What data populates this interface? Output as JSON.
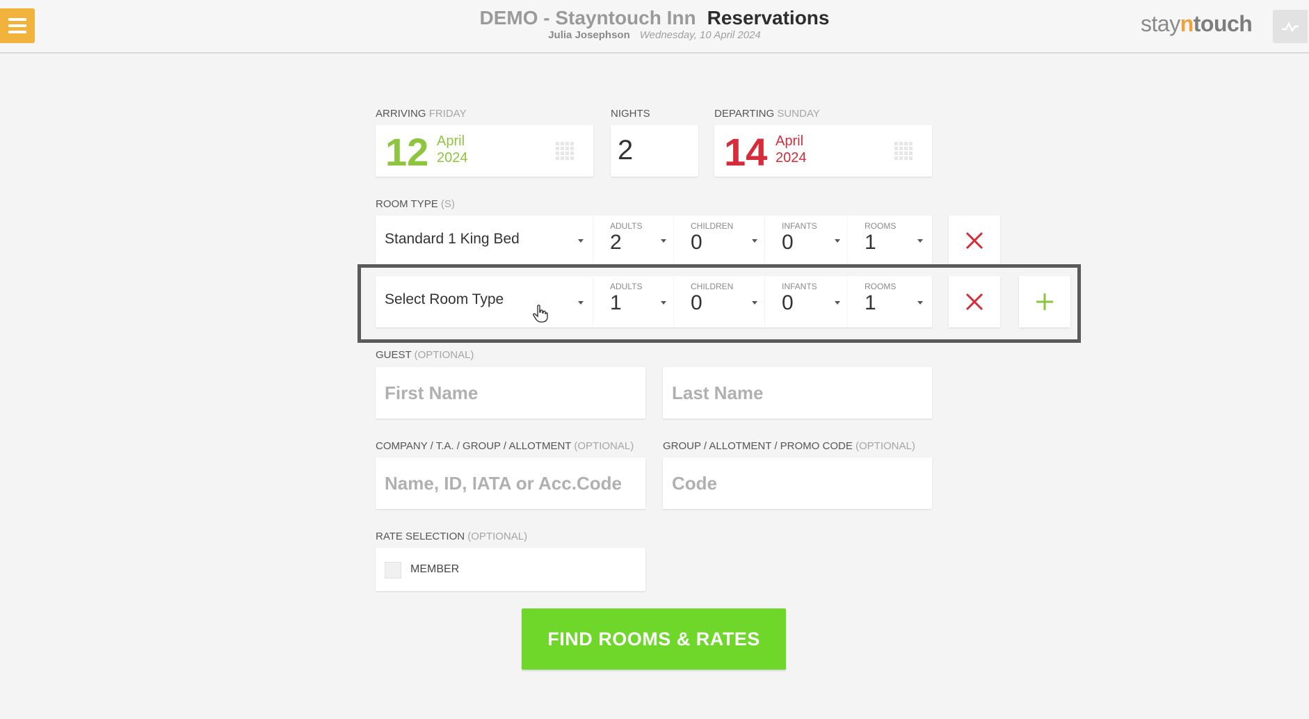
{
  "header": {
    "hotel_name": "DEMO - Stayntouch Inn",
    "page_title": "Reservations",
    "user_name": "Julia Josephson",
    "date": "Wednesday, 10 April 2024",
    "brand": {
      "part1": "stay",
      "part2": "n",
      "part3": "touch"
    },
    "accent_color": "#f2b33d"
  },
  "arrival": {
    "label": "ARRIVING",
    "weekday": "FRIDAY",
    "day": "12",
    "month": "April",
    "year": "2024",
    "color": "#8dc53e"
  },
  "nights": {
    "label": "NIGHTS",
    "value": "2"
  },
  "departure": {
    "label": "DEPARTING",
    "weekday": "SUNDAY",
    "day": "14",
    "month": "April",
    "year": "2024",
    "color": "#d62b3a"
  },
  "room_type_section": {
    "label": "ROOM TYPE",
    "suffix": "(S)"
  },
  "rooms": [
    {
      "room_type": "Standard 1 King Bed",
      "adults_label": "ADULTS",
      "adults": "2",
      "children_label": "CHILDREN",
      "children": "0",
      "infants_label": "INFANTS",
      "infants": "0",
      "rooms_label": "ROOMS",
      "rooms": "1"
    },
    {
      "room_type": "Select Room Type",
      "adults_label": "ADULTS",
      "adults": "1",
      "children_label": "CHILDREN",
      "children": "0",
      "infants_label": "INFANTS",
      "infants": "0",
      "rooms_label": "ROOMS",
      "rooms": "1"
    }
  ],
  "guest": {
    "label": "GUEST",
    "optional": "(OPTIONAL)",
    "first_name_placeholder": "First Name",
    "last_name_placeholder": "Last Name"
  },
  "company": {
    "label": "COMPANY / T.A. / GROUP / ALLOTMENT",
    "optional": "(OPTIONAL)",
    "placeholder": "Name, ID, IATA or Acc.Code"
  },
  "promo": {
    "label": "GROUP / ALLOTMENT / PROMO CODE",
    "optional": "(OPTIONAL)",
    "placeholder": "Code"
  },
  "rate_selection": {
    "label": "RATE SELECTION",
    "optional": "(OPTIONAL)",
    "member_label": "MEMBER",
    "member_checked": false
  },
  "find_button": {
    "label": "FIND ROOMS & RATES",
    "color": "#6fd62a"
  },
  "icons": {
    "menu": "hamburger-menu-icon",
    "activity": "activity-chart-icon",
    "calendar": "calendar-icon",
    "remove": "close-x-icon",
    "add": "plus-icon",
    "caret": "caret-down-icon",
    "cursor": "hand-pointer-icon"
  }
}
